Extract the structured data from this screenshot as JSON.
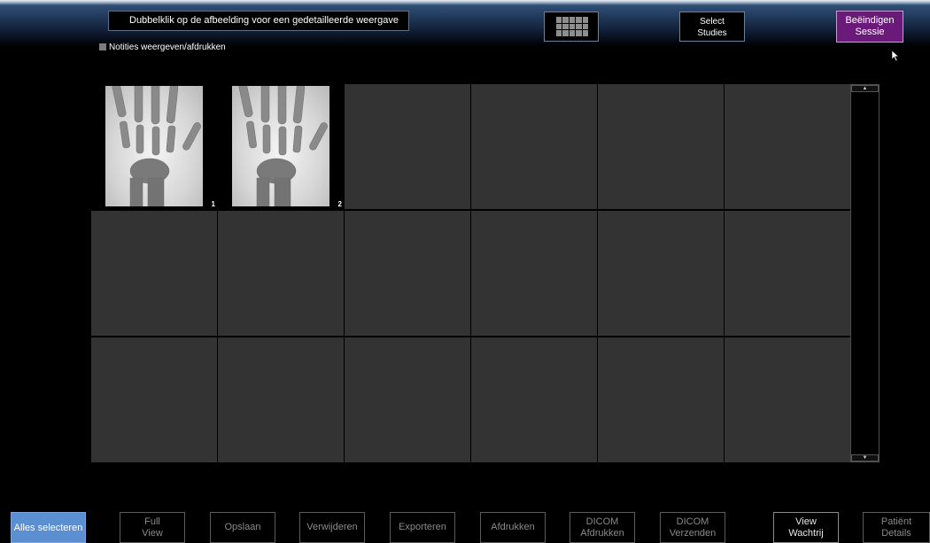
{
  "header": {
    "hint": "Dubbelklik op de afbeelding voor een gedetailleerde weergave",
    "select_studies": [
      "Select",
      "Studies"
    ],
    "end_session": [
      "Beëindigen",
      "Sessie"
    ],
    "notes_toggle": "Notities weergeven/afdrukken"
  },
  "thumbnails": [
    {
      "number": "1"
    },
    {
      "number": "2"
    }
  ],
  "toolbar": {
    "select_all": "Alles selecteren",
    "full_view": [
      "Full",
      "View"
    ],
    "save": "Opslaan",
    "delete": "Verwijderen",
    "export": "Exporteren",
    "print": "Afdrukken",
    "dicom_print": [
      "DICOM",
      "Afdrukken"
    ],
    "dicom_send": [
      "DICOM",
      "Verzenden"
    ],
    "view_queue": [
      "View",
      "Wachtrij"
    ],
    "patient_details": [
      "Patiënt",
      "Details"
    ]
  },
  "icons": {
    "layout": "grid-layout-icon",
    "scroll_up": "arrow-up-icon",
    "scroll_down": "arrow-down-icon",
    "cursor": "mouse-pointer-icon"
  },
  "colors": {
    "end_session_bg": "#6a1a78",
    "select_all_bg": "#5b8fd1",
    "empty_cell": "#333333"
  }
}
